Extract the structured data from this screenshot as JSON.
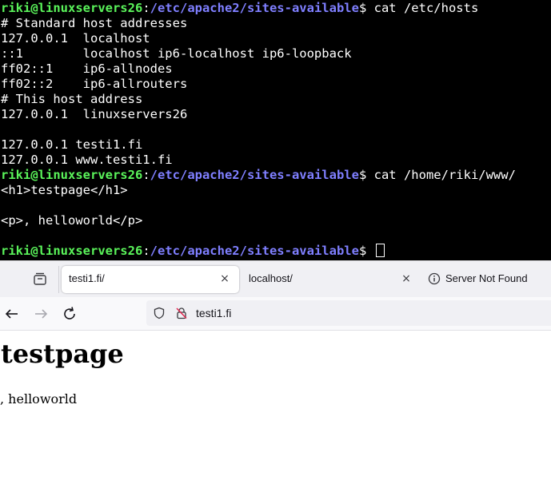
{
  "terminal": {
    "prompt1": {
      "user": "riki@linuxservers26",
      "sep": ":",
      "path": "/etc/apache2/sites-available",
      "dollar": "$ ",
      "command": "cat /etc/hosts"
    },
    "hosts_lines": [
      "# Standard host addresses",
      "127.0.0.1  localhost",
      "::1        localhost ip6-localhost ip6-loopback",
      "ff02::1    ip6-allnodes",
      "ff02::2    ip6-allrouters",
      "# This host address",
      "127.0.0.1  linuxservers26",
      "",
      "127.0.0.1 testi1.fi",
      "127.0.0.1 www.testi1.fi"
    ],
    "prompt2": {
      "user": "riki@linuxservers26",
      "sep": ":",
      "path": "/etc/apache2/sites-available",
      "dollar": "$ ",
      "command": "cat /home/riki/www/"
    },
    "html_lines": [
      "<h1>testpage</h1>",
      "",
      "<p>, helloworld</p>",
      ""
    ],
    "prompt3": {
      "user": "riki@linuxservers26",
      "sep": ":",
      "path": "/etc/apache2/sites-available",
      "dollar": "$ "
    }
  },
  "browser": {
    "tabs": [
      {
        "title": "testi1.fi/",
        "close": "×"
      },
      {
        "title": "localhost/",
        "close": "×"
      },
      {
        "title": "Server Not Found"
      }
    ],
    "url": "testi1.fi",
    "page": {
      "heading": "testpage",
      "paragraph": ", helloworld"
    },
    "colors": {
      "accent": "#0060df",
      "tabstrip": "#f0f0f4",
      "prompt_user": "#5af35a",
      "prompt_path": "#7f7fff"
    }
  }
}
